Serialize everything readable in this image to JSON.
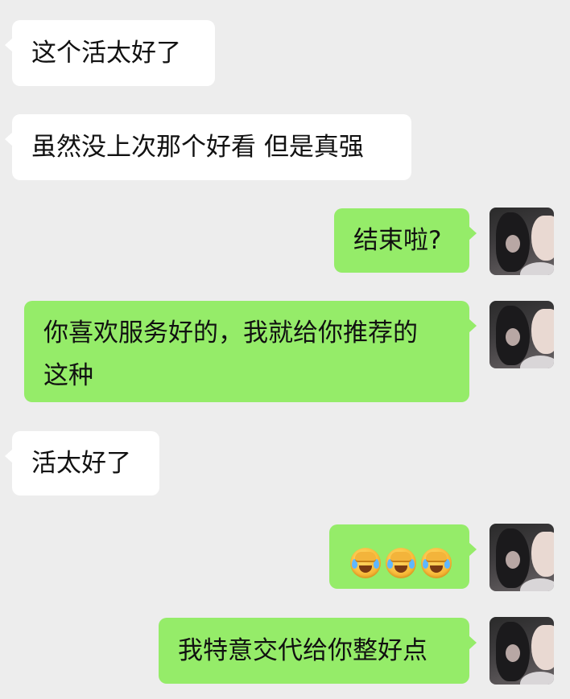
{
  "messages": [
    {
      "side": "left",
      "text": "这个活太好了"
    },
    {
      "side": "left",
      "text": "虽然没上次那个好看 但是真强"
    },
    {
      "side": "right",
      "text": "结束啦?"
    },
    {
      "side": "right",
      "lines": [
        "你喜欢服务好的，我就给你推荐的",
        "这种"
      ]
    },
    {
      "side": "left",
      "text": "活太好了"
    },
    {
      "side": "right",
      "emoji": [
        "face-palm-crying-emoji",
        "face-palm-crying-emoji",
        "face-palm-crying-emoji"
      ]
    },
    {
      "side": "right",
      "text": "我特意交代给你整好点"
    }
  ],
  "colors": {
    "background": "#ededed",
    "incoming": "#ffffff",
    "outgoing": "#95ec69"
  },
  "icons": {
    "avatar": "user-avatar-icon"
  }
}
